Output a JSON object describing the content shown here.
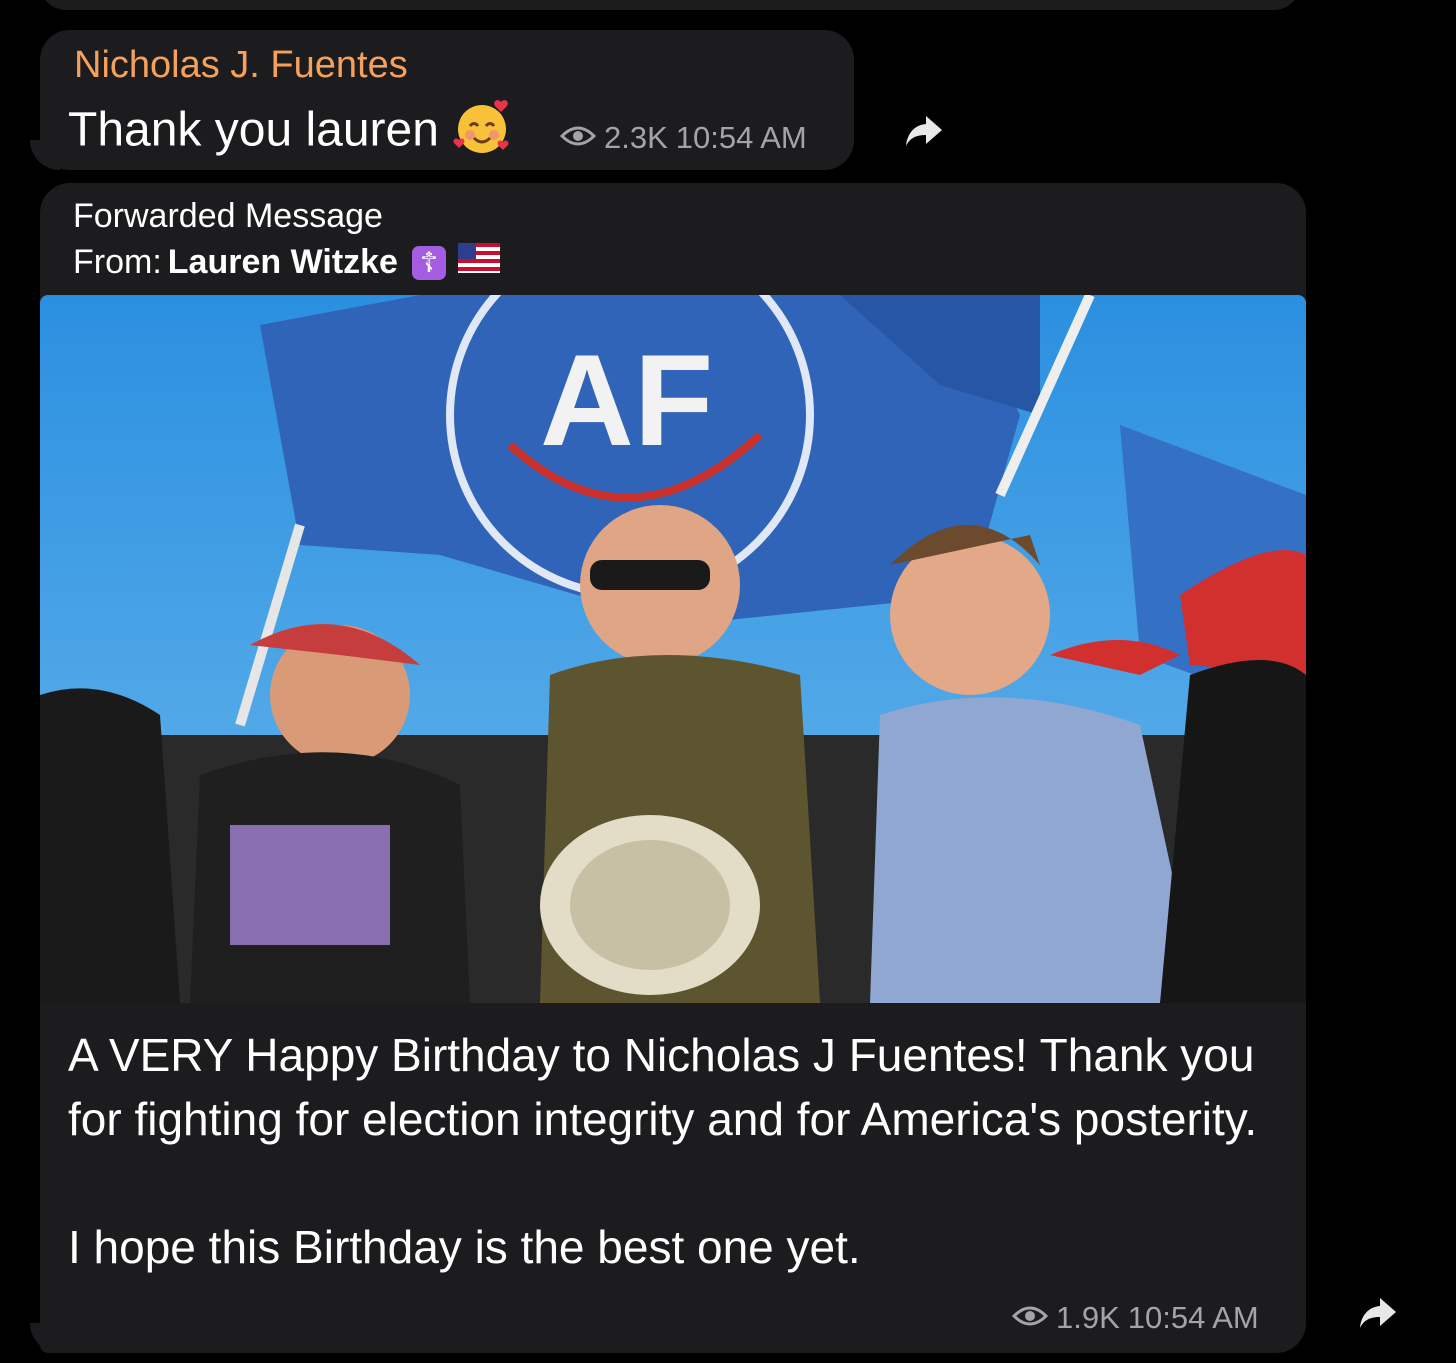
{
  "message1": {
    "sender": "Nicholas J. Fuentes",
    "text": "Thank you lauren",
    "emoji": "smiling-face-with-hearts",
    "views": "2.3K",
    "time": "10:54 AM"
  },
  "message2": {
    "forward_label": "Forwarded Message",
    "from_label": "From:",
    "from_name": "Lauren Witzke",
    "badge": "☦",
    "flag": "us-flag",
    "photo_flag_text": "AF",
    "caption_line1": "A VERY Happy Birthday to Nicholas J Fuentes! Thank you for fighting for election integrity and for America's posterity.",
    "caption_line2": "I hope this Birthday is the best one yet.",
    "views": "1.9K",
    "time": "10:54 AM"
  },
  "colors": {
    "bubble": "#1c1c1e",
    "sender": "#f5a15c",
    "meta": "#a3a3a8",
    "badge": "#a45ce0"
  }
}
